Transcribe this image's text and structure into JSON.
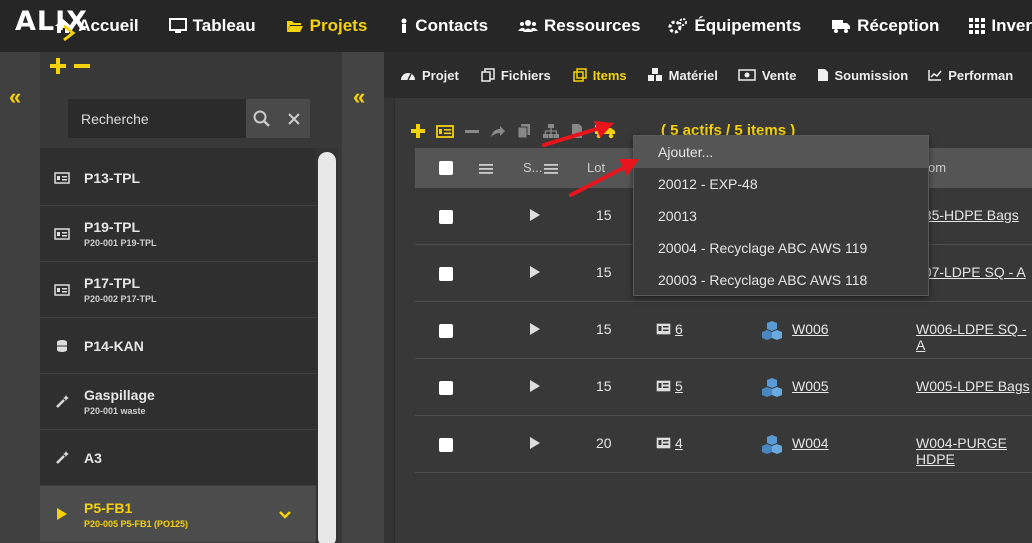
{
  "app": {
    "logo": "ALIX"
  },
  "topnav": [
    {
      "label": "Accueil",
      "icon": "home-icon",
      "active": false
    },
    {
      "label": "Tableau",
      "icon": "monitor-icon",
      "active": false
    },
    {
      "label": "Projets",
      "icon": "folder-open-icon",
      "active": true
    },
    {
      "label": "Contacts",
      "icon": "person-icon",
      "active": false
    },
    {
      "label": "Ressources",
      "icon": "users-icon",
      "active": false
    },
    {
      "label": "Équipements",
      "icon": "cogs-icon",
      "active": false
    },
    {
      "label": "Réception",
      "icon": "truck-icon",
      "active": false
    },
    {
      "label": "Inver",
      "icon": "grid-icon",
      "active": false
    }
  ],
  "sidebar": {
    "collapse_label": "«",
    "search": {
      "value": "Recherche"
    },
    "projects": [
      {
        "name": "P13-TPL",
        "sub": "",
        "icon": "card-icon",
        "selected": false
      },
      {
        "name": "P19-TPL",
        "sub": "P20-001 P19-TPL",
        "icon": "card-icon",
        "selected": false
      },
      {
        "name": "P17-TPL",
        "sub": "P20-002 P17-TPL",
        "icon": "card-icon",
        "selected": false
      },
      {
        "name": "P14-KAN",
        "sub": "",
        "icon": "database-icon",
        "selected": false
      },
      {
        "name": "Gaspillage",
        "sub": "P20-001 waste",
        "icon": "magic-wand-icon",
        "selected": false
      },
      {
        "name": "A3",
        "sub": "",
        "icon": "magic-wand-icon",
        "selected": false
      },
      {
        "name": "P5-FB1",
        "sub": "P20-005 P5-FB1 (PO125)",
        "icon": "play-icon",
        "selected": true
      }
    ]
  },
  "midpanel": {
    "collapse_label": "«"
  },
  "subnav": [
    {
      "label": "Projet",
      "icon": "gauge-icon",
      "active": false
    },
    {
      "label": "Fichiers",
      "icon": "files-icon",
      "active": false
    },
    {
      "label": "Items",
      "icon": "square-icon",
      "active": true
    },
    {
      "label": "Matériel",
      "icon": "cubes-icon",
      "active": false
    },
    {
      "label": "Vente",
      "icon": "money-icon",
      "active": false
    },
    {
      "label": "Soumission",
      "icon": "file-icon",
      "active": false
    },
    {
      "label": "Performan",
      "icon": "chart-icon",
      "active": false
    }
  ],
  "toolbar": {
    "status": "( 5 actifs / 5 items )"
  },
  "table": {
    "headers": {
      "s": "S...",
      "lot": "Lot",
      "nom": "om"
    },
    "rows": [
      {
        "lot": "15",
        "badge": "",
        "item": "",
        "name": "085-HDPE Bags"
      },
      {
        "lot": "15",
        "badge": "",
        "item": "",
        "name": "007-LDPE SQ - A"
      },
      {
        "lot": "15",
        "badge": "6",
        "item": "W006",
        "name": "W006-LDPE SQ - A"
      },
      {
        "lot": "15",
        "badge": "5",
        "item": "W005",
        "name": "W005-LDPE Bags"
      },
      {
        "lot": "20",
        "badge": "4",
        "item": "W004",
        "name": "W004-PURGE HDPE"
      }
    ]
  },
  "dropdown": {
    "items": [
      "Ajouter...",
      "20012 - EXP-48",
      "20013",
      "20004 - Recyclage ABC AWS 119",
      "20003 - Recyclage ABC AWS 118"
    ]
  },
  "colors": {
    "accent": "#f5d20a",
    "annotation_arrow": "#e8141b"
  }
}
